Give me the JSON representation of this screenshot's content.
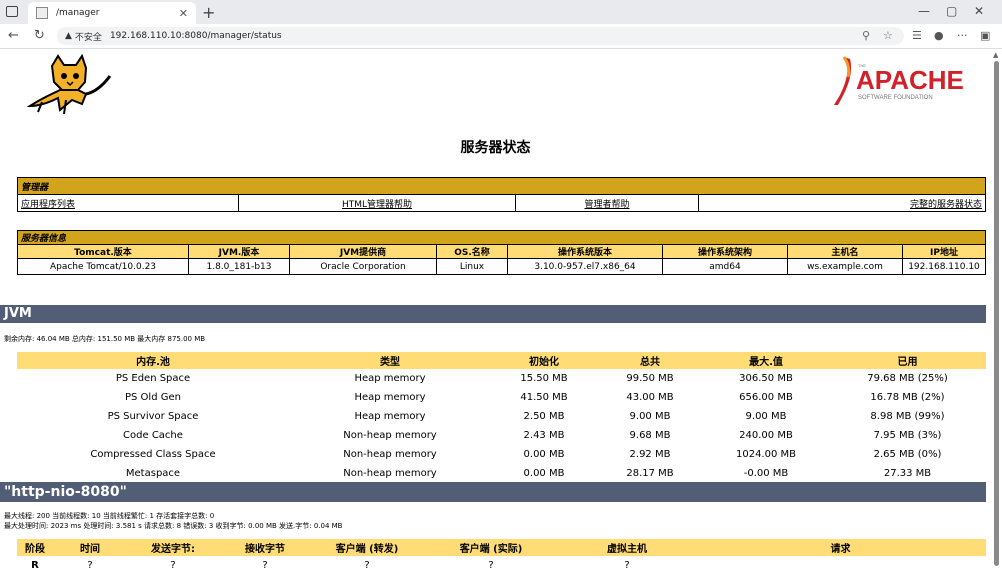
{
  "browser": {
    "tab_title": "/manager",
    "insecure_label": "不安全",
    "url": "192.168.110.10:8080/manager/status"
  },
  "page": {
    "title": "服务器状态"
  },
  "manager": {
    "section": "管理器",
    "links": [
      "应用程序列表",
      "HTML管理器帮助",
      "管理者帮助",
      "完整的服务器状态"
    ]
  },
  "server_info": {
    "section": "服务器信息",
    "headers": [
      "Tomcat.版本",
      "JVM.版本",
      "JVM提供商",
      "OS.名称",
      "操作系统版本",
      "操作系统架构",
      "主机名",
      "IP地址"
    ],
    "values": [
      "Apache Tomcat/10.0.23",
      "1.8.0_181-b13",
      "Oracle Corporation",
      "Linux",
      "3.10.0-957.el7.x86_64",
      "amd64",
      "ws.example.com",
      "192.168.110.10"
    ]
  },
  "jvm": {
    "title": "JVM",
    "summary": "剩余内存:  46.04 MB 总内存:  151.50 MB 最大内存 875.00 MB",
    "headers": [
      "内存.池",
      "类型",
      "初始化",
      "总共",
      "最大.值",
      "已用"
    ],
    "rows": [
      [
        "PS Eden Space",
        "Heap memory",
        "15.50 MB",
        "99.50 MB",
        "306.50 MB",
        "79.68 MB (25%)"
      ],
      [
        "PS Old Gen",
        "Heap memory",
        "41.50 MB",
        "43.00 MB",
        "656.00 MB",
        "16.78 MB (2%)"
      ],
      [
        "PS Survivor Space",
        "Heap memory",
        "2.50 MB",
        "9.00 MB",
        "9.00 MB",
        "8.98 MB (99%)"
      ],
      [
        "Code Cache",
        "Non-heap memory",
        "2.43 MB",
        "9.68 MB",
        "240.00 MB",
        "7.95 MB (3%)"
      ],
      [
        "Compressed Class Space",
        "Non-heap memory",
        "0.00 MB",
        "2.92 MB",
        "1024.00 MB",
        "2.65 MB (0%)"
      ],
      [
        "Metaspace",
        "Non-heap memory",
        "0.00 MB",
        "28.17 MB",
        "-0.00 MB",
        "27.33 MB"
      ]
    ]
  },
  "connector": {
    "title": "\"http-nio-8080\"",
    "line1": "最大线程:  200 当前线程数:  10 当前线程繁忙:  1 存活套接字总数:  0",
    "line2": "最大处理时间:  2023 ms 处理时间:  3.581 s 请求总数:  8 错误数:  3 收到字节:  0.00 MB 发送.字节:  0.04 MB",
    "headers": [
      "阶段",
      "时间",
      "发送字节:",
      "接收字节",
      "客户端 (转发)",
      "客户端 (实际)",
      "虚拟主机",
      "请求"
    ],
    "row": [
      "R",
      "?",
      "?",
      "?",
      "?",
      "?",
      "?",
      ""
    ]
  }
}
